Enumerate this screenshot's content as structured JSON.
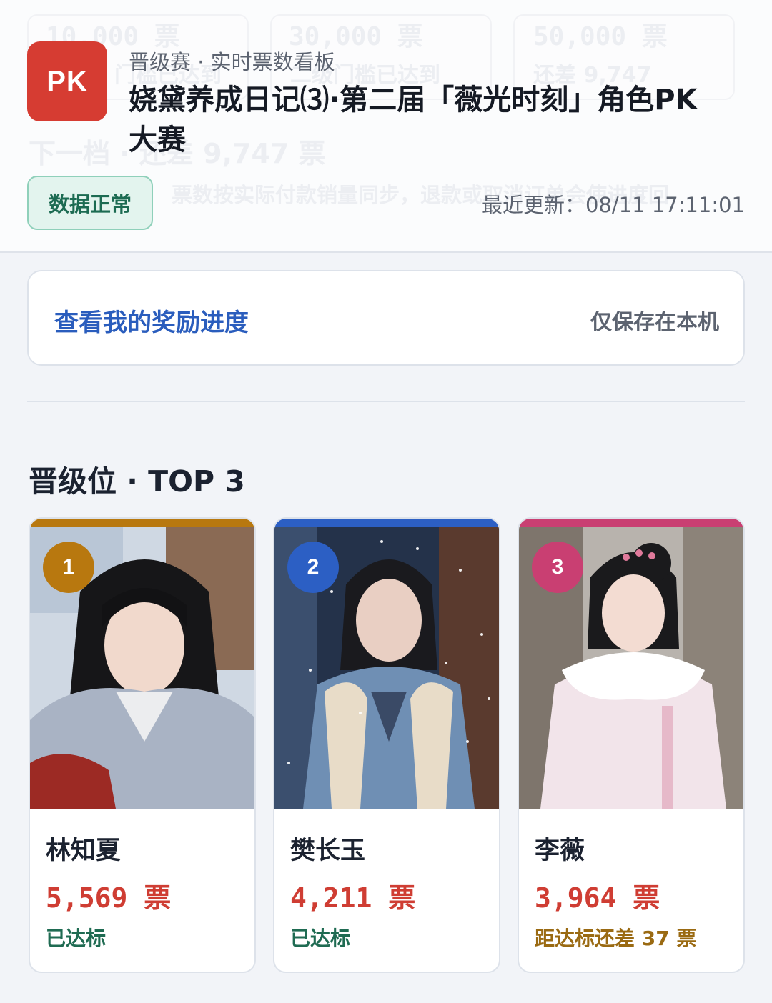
{
  "header": {
    "logo_text": "PK",
    "subtitle": "晋级赛 · 实时票数看板",
    "title": "娆黛养成日记⑶·第二届「薇光时刻」角色PK 大赛",
    "status_badge": "数据正常",
    "last_updated": "最近更新：08/11 17:11:01",
    "background_text": {
      "tier_1": "10,000 票",
      "tier_2": "30,000 票",
      "tier_3": "50,000 票",
      "tier_1_note": "门槛已达到",
      "tier_2_note": "二级门槛已达到",
      "tier_3_note": "还差 9,747",
      "next_tier": "下一档 · 还差 9,747 票",
      "sync_note": "票数按实际付款销量同步，退款或取消订单会使进度回"
    }
  },
  "reward": {
    "link_label": "查看我的奖励进度",
    "note": "仅保存在本机"
  },
  "section": {
    "title": "晋级位 · TOP 3"
  },
  "colors": {
    "rank_1": "#b8780f",
    "rank_2": "#2c5fc4",
    "rank_3": "#c93f72",
    "reached": "#1f6b52",
    "pending": "#9a6a12",
    "votes": "#cf3d33"
  },
  "contestants": [
    {
      "rank": "1",
      "name": "林知夏",
      "votes": "5,569 票",
      "status": "已达标",
      "photo_icon": "portrait-image"
    },
    {
      "rank": "2",
      "name": "樊长玉",
      "votes": "4,211 票",
      "status": "已达标",
      "photo_icon": "portrait-image"
    },
    {
      "rank": "3",
      "name": "李薇",
      "votes": "3,964 票",
      "status": "距达标还差 37 票",
      "photo_icon": "portrait-image"
    }
  ]
}
